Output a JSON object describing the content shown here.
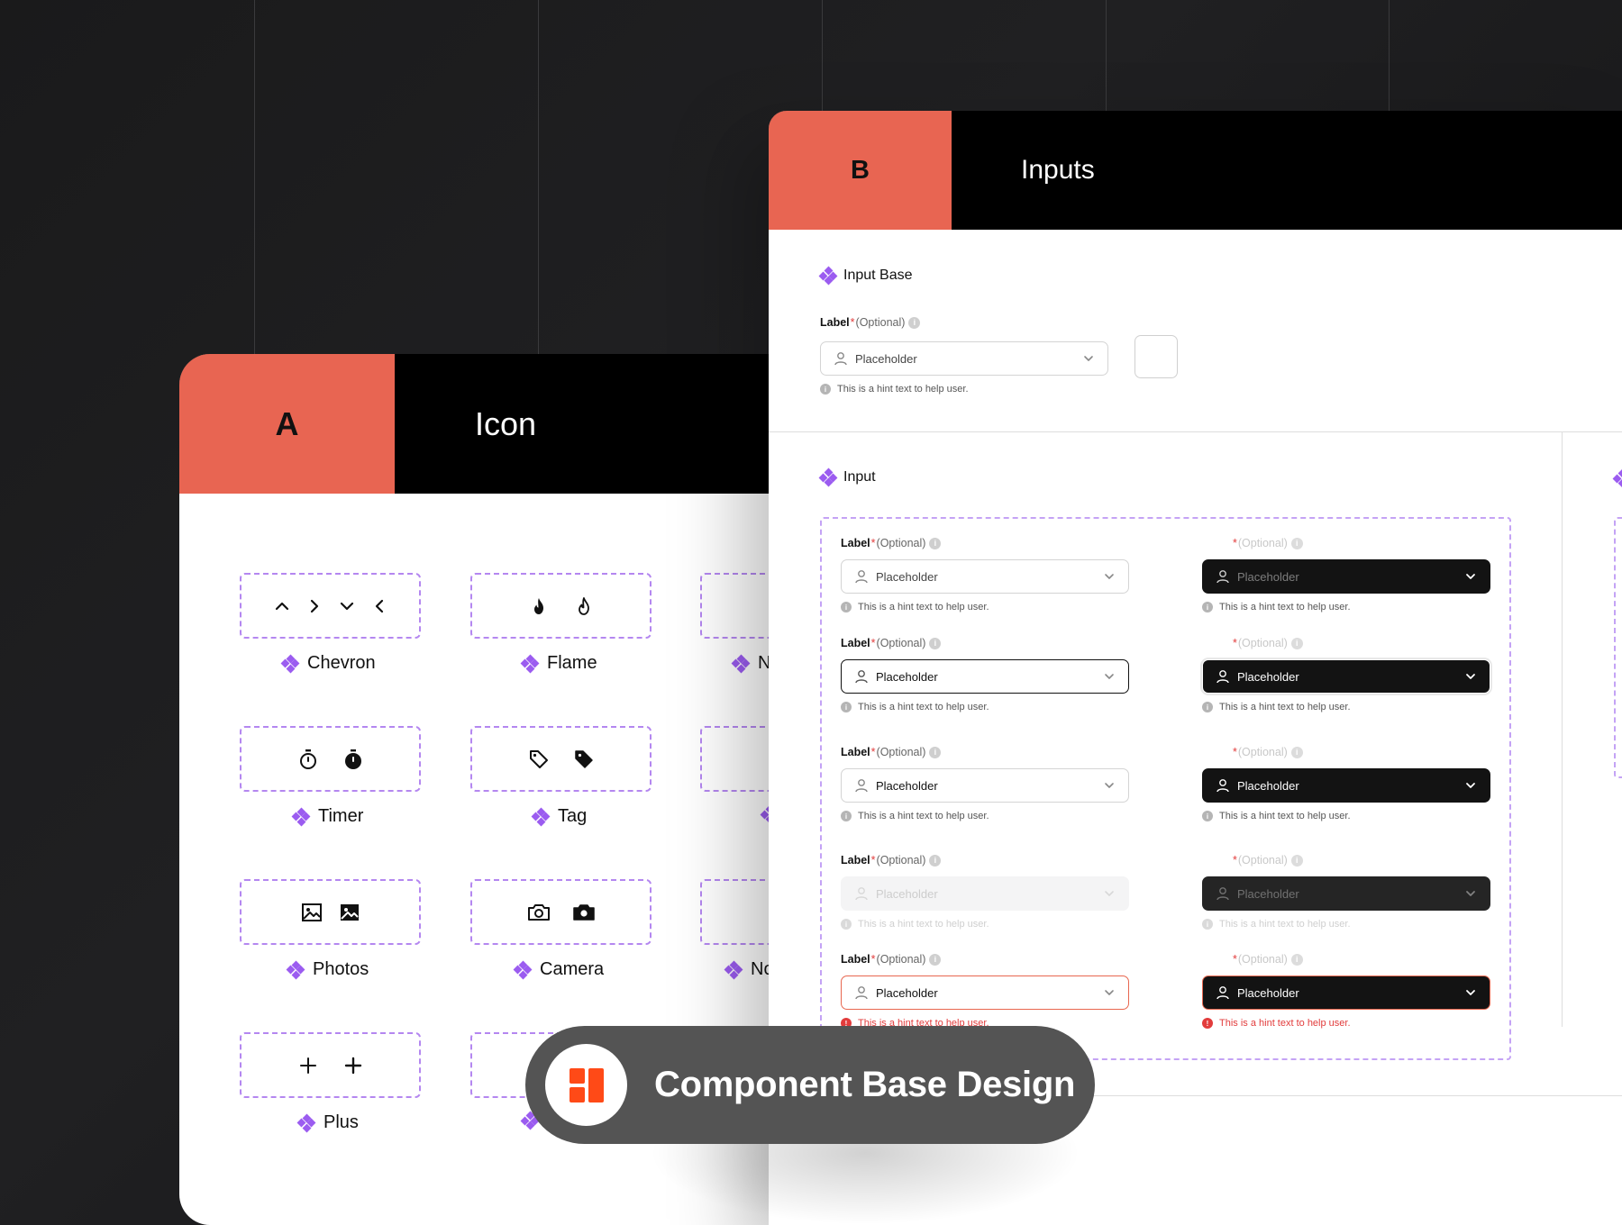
{
  "card_a": {
    "letter": "A",
    "title": "Icon",
    "labels": [
      "Chevron",
      "Flame",
      "N",
      "Timer",
      "Tag",
      "Photos",
      "Camera",
      "No",
      "Plus"
    ]
  },
  "card_b": {
    "letter": "B",
    "title": "Inputs",
    "input_base": {
      "title": "Input Base",
      "label": "Label",
      "required": "*",
      "optional": "(Optional)",
      "placeholder": "Placeholder",
      "hint": "This is a hint text to help user."
    },
    "input": {
      "title": "Input",
      "label": "Label",
      "required": "*",
      "optional": "(Optional)",
      "placeholder": "Placeholder",
      "hint": "This is a hint text to help user.",
      "states": [
        "default",
        "focused",
        "filled",
        "disabled",
        "error"
      ]
    }
  },
  "badge": {
    "text": "Component Base Design"
  },
  "colors": {
    "accent": "#e86552",
    "component_purple": "#9b5cf0",
    "dashed_border": "#b487f0",
    "error": "#e23c3c",
    "dark_field": "#131313"
  }
}
